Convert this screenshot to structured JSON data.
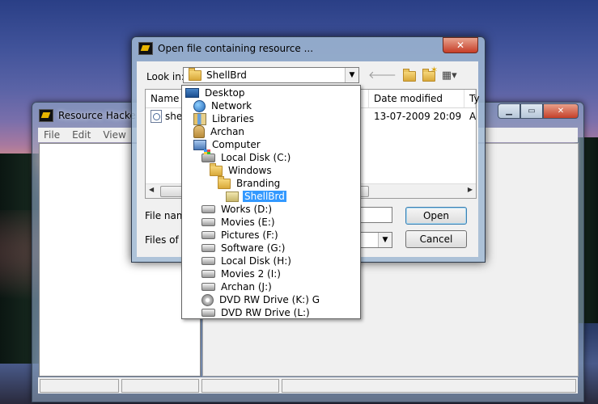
{
  "rh_window": {
    "title": "Resource Hacker",
    "menu": [
      "File",
      "Edit",
      "View"
    ],
    "caption_icons": [
      "minimize-icon",
      "maximize-icon",
      "close-icon"
    ]
  },
  "dialog": {
    "title": "Open file containing resource ...",
    "look_in_label": "Look in:",
    "look_in_value": "ShellBrd",
    "columns": [
      "Name",
      "Date modified",
      "Ty"
    ],
    "files": [
      {
        "name": "shel",
        "date": "13-07-2009 20:09",
        "type": "Ap"
      }
    ],
    "file_name_label": "File name",
    "files_of_type_label": "Files of typ",
    "open_label": "Open",
    "cancel_label": "Cancel",
    "toolbar_icons": [
      "back-arrow-icon",
      "up-folder-icon",
      "new-folder-icon",
      "view-menu-icon"
    ]
  },
  "lookin_tree": [
    {
      "label": "Desktop",
      "icon": "desktop-icon",
      "level": 0
    },
    {
      "label": "Network",
      "icon": "network-icon",
      "level": 1
    },
    {
      "label": "Libraries",
      "icon": "libraries-icon",
      "level": 1
    },
    {
      "label": "Archan",
      "icon": "user-folder-icon",
      "level": 1
    },
    {
      "label": "Computer",
      "icon": "computer-icon",
      "level": 1
    },
    {
      "label": "Local Disk (C:)",
      "icon": "windows-disk-icon",
      "level": 2
    },
    {
      "label": "Windows",
      "icon": "folder-icon",
      "level": 3
    },
    {
      "label": "Branding",
      "icon": "folder-icon",
      "level": 4
    },
    {
      "label": "ShellBrd",
      "icon": "folder-open-icon",
      "level": 5,
      "selected": true
    },
    {
      "label": "Works (D:)",
      "icon": "disk-icon",
      "level": 2
    },
    {
      "label": "Movies (E:)",
      "icon": "disk-icon",
      "level": 2
    },
    {
      "label": "Pictures (F:)",
      "icon": "disk-icon",
      "level": 2
    },
    {
      "label": "Software (G:)",
      "icon": "disk-icon",
      "level": 2
    },
    {
      "label": "Local Disk (H:)",
      "icon": "disk-icon",
      "level": 2
    },
    {
      "label": "Movies  2 (I:)",
      "icon": "disk-icon",
      "level": 2
    },
    {
      "label": "Archan (J:)",
      "icon": "disk-icon",
      "level": 2
    },
    {
      "label": "DVD RW Drive (K:) G",
      "icon": "dvd-icon",
      "level": 2
    },
    {
      "label": "DVD RW Drive (L:)",
      "icon": "disk-icon",
      "level": 2
    }
  ]
}
